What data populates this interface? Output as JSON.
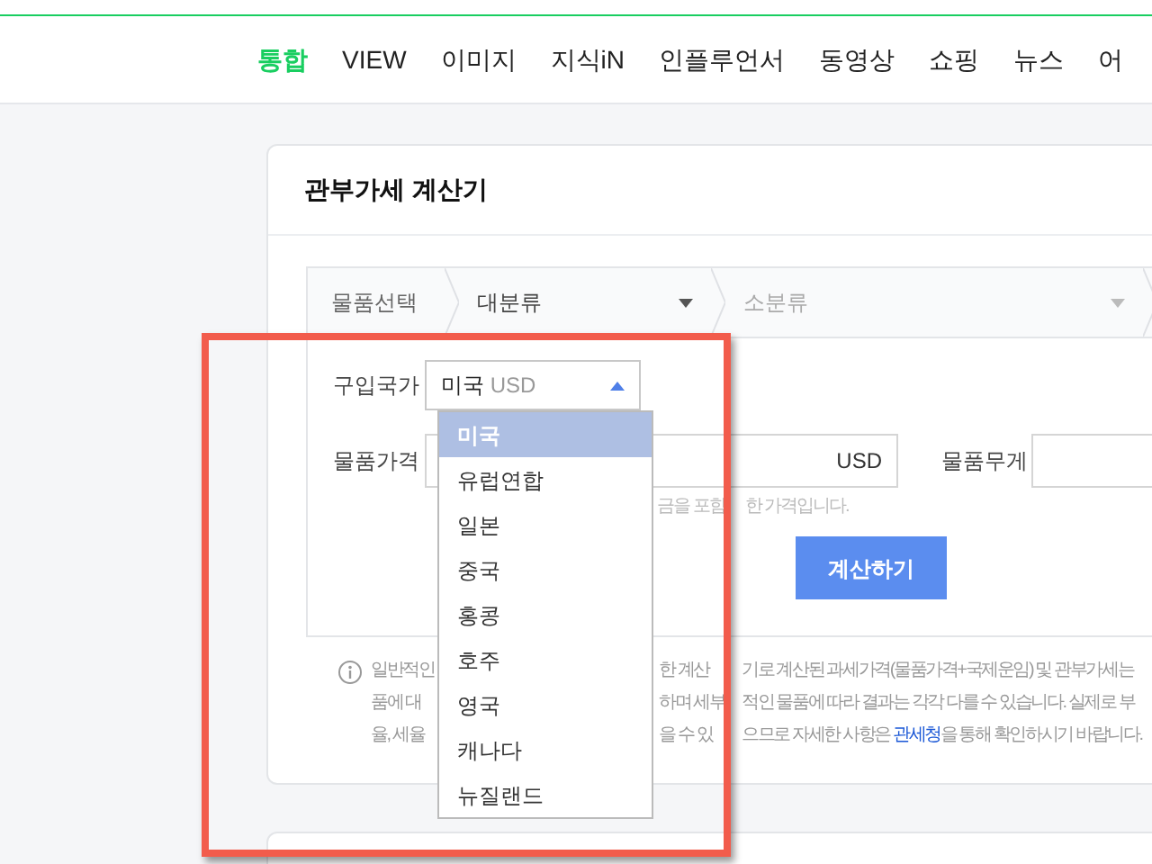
{
  "nav": {
    "tabs": [
      {
        "label": "통합",
        "selected": true
      },
      {
        "label": "VIEW",
        "selected": false
      },
      {
        "label": "이미지",
        "selected": false
      },
      {
        "label": "지식iN",
        "selected": false
      },
      {
        "label": "인플루언서",
        "selected": false
      },
      {
        "label": "동영상",
        "selected": false
      },
      {
        "label": "쇼핑",
        "selected": false
      },
      {
        "label": "뉴스",
        "selected": false
      },
      {
        "label": "어",
        "selected": false
      }
    ]
  },
  "calculator": {
    "title": "관부가세 계산기",
    "category_bar": {
      "label": "물품선택",
      "major": "대분류",
      "minor": "소분류"
    },
    "country": {
      "label": "구입국가",
      "value": "미국",
      "currency": "USD",
      "expanded": true,
      "options": [
        {
          "label": "미국",
          "selected": true
        },
        {
          "label": "유럽연합",
          "selected": false
        },
        {
          "label": "일본",
          "selected": false
        },
        {
          "label": "중국",
          "selected": false
        },
        {
          "label": "홍콩",
          "selected": false
        },
        {
          "label": "호주",
          "selected": false
        },
        {
          "label": "영국",
          "selected": false
        },
        {
          "label": "캐나다",
          "selected": false
        },
        {
          "label": "뉴질랜드",
          "selected": false
        }
      ]
    },
    "price": {
      "label": "물품가격",
      "unit": "USD",
      "hint_parts": [
        "금을 포함",
        "한 가격입니다."
      ]
    },
    "weight": {
      "label": "물품무게"
    },
    "button": "계산하기",
    "info_lines": [
      {
        "left": "일반적인",
        "middle": "한 계산",
        "right": "기로 계산된 과세가격(물품가격+국제운임) 및 관부가세는"
      },
      {
        "left": "품에 대",
        "middle": "하며 세부",
        "right": "적인 물품에 따라 결과는 각각 다를 수 있습니다. 실제로 부"
      },
      {
        "left": "율, 세율",
        "middle": "을 수 있",
        "right": "으므로 자세한 사항은",
        "link": "관세청",
        "after": "을 통해 확인하시기 바랍니다."
      }
    ]
  },
  "annotation": {
    "kind": "frame"
  }
}
